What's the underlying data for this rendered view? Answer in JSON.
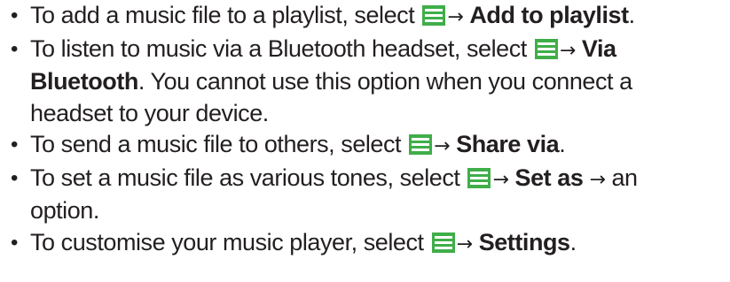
{
  "bullet_char": "•",
  "arrow": "→",
  "menu_icon_name": "menu-icon",
  "icon_color": "#3fae49",
  "items": [
    {
      "lines": [
        {
          "pre": "To add a music file to a playlist, select ",
          "bold1": "Add to playlist",
          "post": "."
        }
      ]
    },
    {
      "lines": [
        {
          "pre": "To listen to music via a Bluetooth headset, select ",
          "bold1": "Via"
        },
        {
          "bold1": "Bluetooth",
          "post": ". You cannot use this option when you connect a"
        },
        {
          "text": "headset to your device."
        }
      ]
    },
    {
      "lines": [
        {
          "pre": "To send a music file to others, select ",
          "bold1": "Share via",
          "post": "."
        }
      ]
    },
    {
      "lines": [
        {
          "pre": "To set a music file as various tones, select ",
          "bold1": "Set as",
          "post": " an"
        },
        {
          "text": "option."
        }
      ]
    },
    {
      "lines": [
        {
          "pre": "To customise your music player, select ",
          "bold1": "Settings",
          "post": "."
        }
      ]
    }
  ]
}
